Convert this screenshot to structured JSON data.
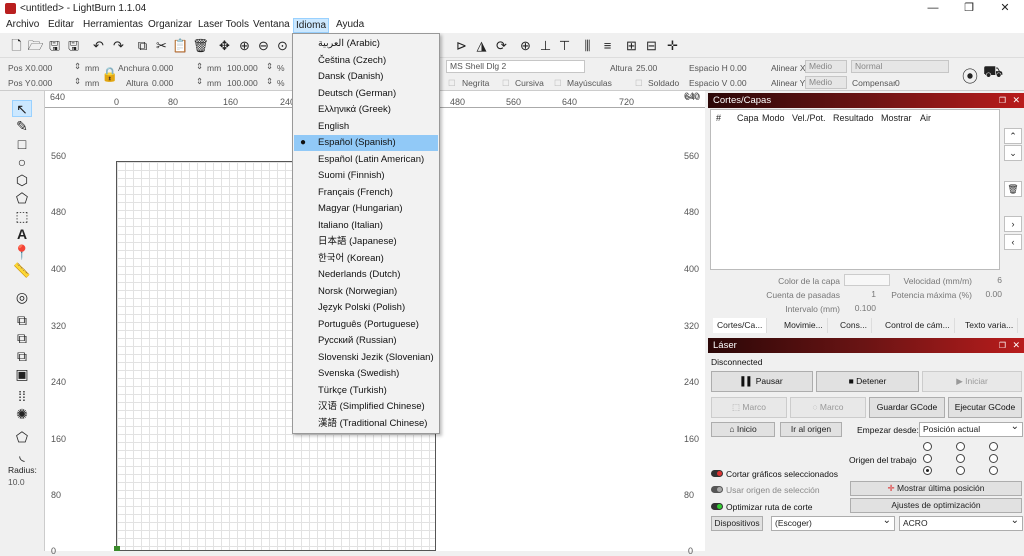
{
  "title": "<untitled> - LightBurn 1.1.04",
  "menu": [
    "Archivo",
    "Editar",
    "Herramientas",
    "Organizar",
    "Laser Tools",
    "Ventana",
    "Idioma",
    "Ayuda"
  ],
  "numeric": {
    "posx_label": "Pos X",
    "posx": "0.000",
    "posy_label": "Pos Y",
    "posy": "0.000",
    "unit": "mm",
    "width_label": "Anchura",
    "width": "0.000",
    "height_label": "Altura",
    "height": "0.000",
    "scale_w": "100.000",
    "scale_h": "100.000",
    "pct": "%",
    "font": "MS Shell Dlg 2",
    "altura_label": "Altura",
    "altura": "25.00",
    "spaceh_label": "Espacio H",
    "spaceh": "0.00",
    "spacev_label": "Espacio V",
    "spacev": "0.00",
    "alignx_label": "Alinear X",
    "alignx": "Medio",
    "aligny_label": "Alinear Y",
    "aligny": "Medio",
    "normal": "Normal",
    "offset_label": "Compensar",
    "offset": "0",
    "bold": "Negrita",
    "italic": "Cursiva",
    "upper": "Mayúsculas",
    "welded": "Soldado"
  },
  "languages": [
    "العربية (Arabic)",
    "Čeština (Czech)",
    "Dansk (Danish)",
    "Deutsch (German)",
    "Ελληνικά (Greek)",
    "English",
    "Español (Spanish)",
    "Español (Latin American)",
    "Suomi (Finnish)",
    "Français (French)",
    "Magyar (Hungarian)",
    "Italiano (Italian)",
    "日本語 (Japanese)",
    "한국어 (Korean)",
    "Nederlands (Dutch)",
    "Norsk (Norwegian)",
    "Język Polski (Polish)",
    "Português (Portuguese)",
    "Русский (Russian)",
    "Slovenski Jezik (Slovenian)",
    "Svenska (Swedish)",
    "Türkçe (Turkish)",
    "汉语 (Simplified Chinese)",
    "漢語 (Traditional Chinese)"
  ],
  "selected_language": "Español (Spanish)",
  "ruler": {
    "top": [
      "0",
      "80",
      "160",
      "240",
      "480",
      "560",
      "640",
      "720",
      "640"
    ],
    "topleft": "640",
    "left": [
      "560",
      "480",
      "400",
      "320",
      "240",
      "160",
      "80",
      "0"
    ],
    "right": [
      "560",
      "480",
      "400",
      "320",
      "240",
      "160",
      "80",
      "0"
    ],
    "rightTop": "640"
  },
  "leftpanel": {
    "radius_label": "Radius:",
    "radius": "10.0"
  },
  "cuts": {
    "title": "Cortes/Capas",
    "columns": [
      "#",
      "Capa",
      "Modo",
      "Vel./Pot.",
      "Resultado",
      "Mostrar",
      "Air"
    ],
    "color_label": "Color de la capa",
    "speed_label": "Velocidad (mm/m)",
    "speed": "6",
    "passes_label": "Cuenta de pasadas",
    "passes": "1",
    "power_label": "Potencia máxima (%)",
    "power": "0.00",
    "interval_label": "Intervalo (mm)",
    "interval": "0.100"
  },
  "tabs": [
    "Cortes/Ca...",
    "Movimie...",
    "Cons...",
    "Control de cám...",
    "Texto varia..."
  ],
  "laser": {
    "title": "Láser",
    "status": "Disconnected",
    "pause": "Pausar",
    "stop": "Detener",
    "start": "Iniciar",
    "frame1": "Marco",
    "frame2": "Marco",
    "save": "Guardar GCode",
    "run": "Ejecutar GCode",
    "home": "Inicio",
    "goorigin": "Ir al origen",
    "startfrom_label": "Empezar desde:",
    "startfrom": "Posición actual",
    "origin_label": "Origen del trabajo",
    "cutsel": "Cortar gráficos seleccionados",
    "useorigin": "Usar origen de selección",
    "optimize": "Optimizar ruta de corte",
    "showpos": "Mostrar última posición",
    "optsettings": "Ajustes de optimización",
    "devices": "Dispositivos",
    "choose": "(Escoger)",
    "device": "ACRO"
  }
}
